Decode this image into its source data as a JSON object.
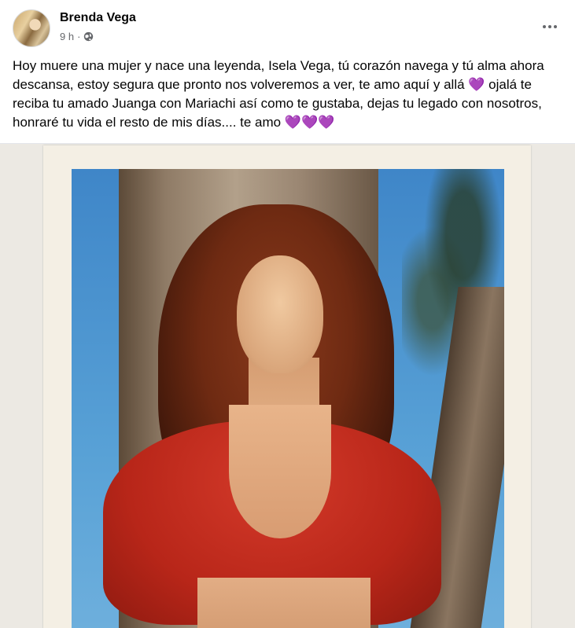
{
  "post": {
    "author": "Brenda Vega",
    "time": "9 h",
    "separator": "·",
    "privacy_icon": "globe-icon",
    "more_icon": "more-options-icon",
    "text": "Hoy muere una mujer y nace una leyenda, Isela Vega, tú corazón navega y tú alma ahora descansa, estoy segura que pronto nos volveremos a ver, te amo aquí y allá 💜 ojalá te reciba tu amado Juanga con Mariachi así como te gustaba, dejas tu legado con nosotros, honraré tu vida el resto de mis días.... te amo 💜💜💜"
  },
  "colors": {
    "text": "#050505",
    "secondary": "#65676b"
  }
}
